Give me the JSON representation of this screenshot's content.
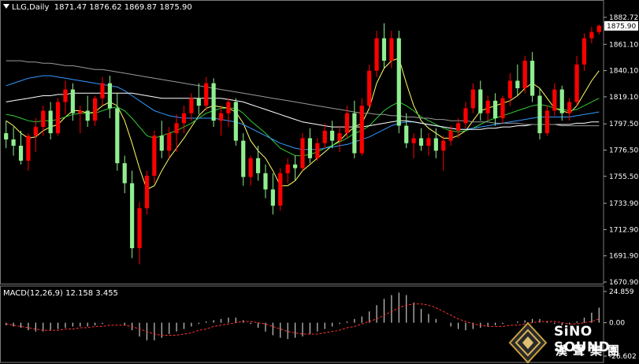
{
  "header": {
    "symbol": "LLG,Daily",
    "ohlc": "1871.47 1876.62 1869.87 1875.90",
    "macd_label": "MACD(12,26,9) 12.158 3.455"
  },
  "brand": {
    "name_en": "SiNO SOUND",
    "name_zh": "漢聲集團"
  },
  "colors": {
    "background": "#000000",
    "bull_candle": "#ff0000",
    "bear_candle": "#90ee90",
    "ma_yellow": "#ffff66",
    "ma_green": "#33cc33",
    "ma_blue": "#3399ff",
    "ma_white": "#ffffff",
    "ma_gray": "#999999",
    "macd_hist": "#c8c8c8",
    "macd_signal": "#ff3333"
  },
  "chart_data": [
    {
      "type": "candlestick",
      "name": "LLG,Daily",
      "ylim": [
        1670.9,
        1882.72
      ],
      "yticks": [
        1882.72,
        1861.1,
        1840.1,
        1819.1,
        1797.5,
        1776.5,
        1755.5,
        1733.9,
        1712.9,
        1691.9,
        1670.9
      ],
      "current_price": 1875.9,
      "current_price_label": "1875.90",
      "ohlc": [
        [
          1790,
          1800,
          1778,
          1785
        ],
        [
          1785,
          1795,
          1772,
          1780
        ],
        [
          1780,
          1792,
          1765,
          1768
        ],
        [
          1768,
          1790,
          1760,
          1788
        ],
        [
          1788,
          1802,
          1775,
          1795
        ],
        [
          1795,
          1812,
          1788,
          1808
        ],
        [
          1808,
          1815,
          1785,
          1790
        ],
        [
          1790,
          1818,
          1788,
          1815
        ],
        [
          1815,
          1832,
          1805,
          1825
        ],
        [
          1825,
          1830,
          1800,
          1806
        ],
        [
          1806,
          1812,
          1790,
          1808
        ],
        [
          1808,
          1820,
          1795,
          1800
        ],
        [
          1800,
          1820,
          1796,
          1818
        ],
        [
          1818,
          1835,
          1812,
          1830
        ],
        [
          1830,
          1836,
          1802,
          1810
        ],
        [
          1810,
          1822,
          1760,
          1766
        ],
        [
          1766,
          1772,
          1742,
          1750
        ],
        [
          1750,
          1760,
          1690,
          1698
        ],
        [
          1698,
          1735,
          1685,
          1730
        ],
        [
          1730,
          1760,
          1725,
          1756
        ],
        [
          1756,
          1792,
          1750,
          1788
        ],
        [
          1788,
          1800,
          1770,
          1776
        ],
        [
          1776,
          1795,
          1770,
          1790
        ],
        [
          1790,
          1805,
          1775,
          1798
        ],
        [
          1798,
          1812,
          1790,
          1806
        ],
        [
          1806,
          1822,
          1800,
          1818
        ],
        [
          1818,
          1830,
          1805,
          1812
        ],
        [
          1812,
          1835,
          1808,
          1830
        ],
        [
          1830,
          1834,
          1795,
          1800
        ],
        [
          1800,
          1812,
          1788,
          1806
        ],
        [
          1806,
          1818,
          1795,
          1815
        ],
        [
          1815,
          1818,
          1780,
          1784
        ],
        [
          1784,
          1790,
          1748,
          1755
        ],
        [
          1755,
          1772,
          1748,
          1770
        ],
        [
          1770,
          1780,
          1752,
          1758
        ],
        [
          1758,
          1765,
          1738,
          1745
        ],
        [
          1745,
          1758,
          1725,
          1732
        ],
        [
          1732,
          1762,
          1728,
          1758
        ],
        [
          1758,
          1770,
          1750,
          1765
        ],
        [
          1765,
          1772,
          1752,
          1762
        ],
        [
          1762,
          1790,
          1760,
          1786
        ],
        [
          1786,
          1794,
          1766,
          1770
        ],
        [
          1770,
          1786,
          1768,
          1782
        ],
        [
          1782,
          1798,
          1778,
          1792
        ],
        [
          1792,
          1800,
          1778,
          1784
        ],
        [
          1784,
          1796,
          1775,
          1790
        ],
        [
          1790,
          1812,
          1786,
          1806
        ],
        [
          1806,
          1816,
          1770,
          1774
        ],
        [
          1774,
          1818,
          1772,
          1812
        ],
        [
          1812,
          1845,
          1810,
          1840
        ],
        [
          1840,
          1872,
          1835,
          1866
        ],
        [
          1866,
          1878,
          1842,
          1848
        ],
        [
          1848,
          1872,
          1842,
          1866
        ],
        [
          1866,
          1872,
          1790,
          1796
        ],
        [
          1796,
          1806,
          1778,
          1782
        ],
        [
          1782,
          1790,
          1770,
          1786
        ],
        [
          1786,
          1794,
          1776,
          1780
        ],
        [
          1780,
          1790,
          1772,
          1786
        ],
        [
          1786,
          1794,
          1770,
          1776
        ],
        [
          1776,
          1788,
          1760,
          1784
        ],
        [
          1784,
          1796,
          1780,
          1792
        ],
        [
          1792,
          1802,
          1786,
          1798
        ],
        [
          1798,
          1815,
          1794,
          1810
        ],
        [
          1810,
          1830,
          1806,
          1825
        ],
        [
          1825,
          1832,
          1800,
          1806
        ],
        [
          1806,
          1820,
          1800,
          1816
        ],
        [
          1816,
          1822,
          1796,
          1802
        ],
        [
          1802,
          1820,
          1798,
          1818
        ],
        [
          1818,
          1838,
          1812,
          1832
        ],
        [
          1832,
          1845,
          1820,
          1826
        ],
        [
          1826,
          1852,
          1822,
          1848
        ],
        [
          1848,
          1855,
          1815,
          1820
        ],
        [
          1820,
          1826,
          1785,
          1790
        ],
        [
          1790,
          1812,
          1788,
          1808
        ],
        [
          1808,
          1830,
          1804,
          1825
        ],
        [
          1825,
          1828,
          1800,
          1806
        ],
        [
          1806,
          1818,
          1800,
          1815
        ],
        [
          1815,
          1852,
          1812,
          1845
        ],
        [
          1845,
          1870,
          1840,
          1866
        ],
        [
          1866,
          1875,
          1862,
          1871
        ],
        [
          1871,
          1877,
          1869,
          1876
        ]
      ],
      "moving_averages": [
        {
          "color": "yellow",
          "values": [
            1800,
            1796,
            1790,
            1786,
            1787,
            1792,
            1795,
            1797,
            1803,
            1808,
            1808,
            1806,
            1807,
            1812,
            1815,
            1812,
            1800,
            1782,
            1762,
            1745,
            1748,
            1760,
            1770,
            1778,
            1786,
            1795,
            1804,
            1810,
            1812,
            1811,
            1810,
            1807,
            1798,
            1784,
            1776,
            1770,
            1760,
            1748,
            1748,
            1752,
            1760,
            1765,
            1770,
            1775,
            1780,
            1784,
            1790,
            1795,
            1798,
            1810,
            1830,
            1842,
            1848,
            1850,
            1830,
            1812,
            1800,
            1794,
            1790,
            1786,
            1786,
            1788,
            1792,
            1800,
            1808,
            1810,
            1812,
            1814,
            1816,
            1820,
            1826,
            1830,
            1826,
            1818,
            1810,
            1808,
            1806,
            1812,
            1822,
            1832,
            1840
          ]
        },
        {
          "color": "green",
          "values": [
            1805,
            1804,
            1802,
            1800,
            1799,
            1800,
            1800,
            1801,
            1803,
            1805,
            1806,
            1806,
            1806,
            1808,
            1810,
            1811,
            1808,
            1802,
            1795,
            1788,
            1786,
            1788,
            1790,
            1792,
            1795,
            1798,
            1802,
            1806,
            1808,
            1810,
            1810,
            1810,
            1806,
            1800,
            1795,
            1790,
            1784,
            1778,
            1775,
            1772,
            1772,
            1773,
            1775,
            1778,
            1780,
            1783,
            1786,
            1790,
            1792,
            1796,
            1802,
            1808,
            1812,
            1815,
            1812,
            1808,
            1803,
            1800,
            1797,
            1794,
            1792,
            1791,
            1792,
            1794,
            1797,
            1800,
            1802,
            1804,
            1806,
            1808,
            1810,
            1812,
            1813,
            1812,
            1810,
            1809,
            1808,
            1809,
            1812,
            1815,
            1818
          ]
        },
        {
          "color": "blue",
          "values": [
            1828,
            1830,
            1832,
            1834,
            1835,
            1836,
            1836,
            1835,
            1834,
            1833,
            1832,
            1831,
            1830,
            1829,
            1828,
            1827,
            1824,
            1820,
            1816,
            1812,
            1808,
            1806,
            1804,
            1803,
            1802,
            1802,
            1802,
            1802,
            1802,
            1801,
            1800,
            1799,
            1797,
            1794,
            1791,
            1788,
            1785,
            1782,
            1780,
            1778,
            1777,
            1777,
            1777,
            1778,
            1779,
            1780,
            1781,
            1783,
            1785,
            1787,
            1790,
            1793,
            1796,
            1798,
            1799,
            1799,
            1798,
            1797,
            1796,
            1795,
            1794,
            1793,
            1793,
            1794,
            1795,
            1796,
            1797,
            1798,
            1799,
            1800,
            1801,
            1802,
            1803,
            1803,
            1803,
            1803,
            1803,
            1804,
            1805,
            1806,
            1807
          ]
        },
        {
          "color": "white",
          "values": [
            1815,
            1816,
            1817,
            1818,
            1819,
            1820,
            1820,
            1821,
            1821,
            1822,
            1822,
            1822,
            1822,
            1822,
            1822,
            1822,
            1822,
            1822,
            1821,
            1820,
            1819,
            1818,
            1818,
            1818,
            1818,
            1818,
            1818,
            1818,
            1818,
            1818,
            1817,
            1816,
            1815,
            1813,
            1811,
            1809,
            1807,
            1805,
            1803,
            1801,
            1799,
            1798,
            1797,
            1796,
            1795,
            1795,
            1795,
            1795,
            1795,
            1796,
            1797,
            1798,
            1799,
            1800,
            1800,
            1799,
            1798,
            1797,
            1796,
            1795,
            1794,
            1793,
            1793,
            1793,
            1793,
            1794,
            1794,
            1795,
            1795,
            1796,
            1796,
            1797,
            1797,
            1797,
            1797,
            1797,
            1797,
            1798,
            1798,
            1799,
            1799
          ]
        },
        {
          "color": "gray",
          "values": [
            1848,
            1848,
            1848,
            1847,
            1847,
            1846,
            1846,
            1845,
            1844,
            1844,
            1843,
            1842,
            1841,
            1841,
            1840,
            1839,
            1838,
            1837,
            1836,
            1835,
            1834,
            1833,
            1832,
            1831,
            1830,
            1829,
            1828,
            1827,
            1826,
            1825,
            1824,
            1823,
            1822,
            1821,
            1820,
            1819,
            1818,
            1817,
            1816,
            1815,
            1814,
            1813,
            1812,
            1811,
            1810,
            1809,
            1808,
            1807,
            1806,
            1806,
            1805,
            1805,
            1804,
            1804,
            1803,
            1803,
            1802,
            1802,
            1801,
            1801,
            1800,
            1800,
            1800,
            1799,
            1799,
            1799,
            1798,
            1798,
            1798,
            1798,
            1797,
            1797,
            1797,
            1797,
            1797,
            1796,
            1796,
            1796,
            1796,
            1796,
            1796
          ]
        }
      ]
    },
    {
      "type": "bar",
      "name": "MACD(12,26,9)",
      "macd_value": 12.158,
      "signal_value": 3.455,
      "ylim": [
        -26.602,
        24.859
      ],
      "yticks": [
        24.859,
        0.0,
        -26.602
      ],
      "histogram": [
        -2,
        -3,
        -4,
        -6,
        -7,
        -7,
        -6,
        -5,
        -4,
        -3,
        -3,
        -3,
        -2,
        -1,
        0,
        0,
        -2,
        -6,
        -11,
        -14,
        -14,
        -12,
        -9,
        -7,
        -5,
        -3,
        -1,
        1,
        2,
        3,
        4,
        4,
        2,
        -1,
        -4,
        -7,
        -10,
        -12,
        -13,
        -12,
        -11,
        -9,
        -7,
        -5,
        -3,
        -1,
        1,
        3,
        5,
        9,
        14,
        19,
        22,
        24,
        22,
        16,
        11,
        7,
        3,
        0,
        -3,
        -5,
        -6,
        -5,
        -4,
        -3,
        -2,
        -1,
        0,
        1,
        2,
        3,
        3,
        1,
        -1,
        -2,
        -1,
        1,
        4,
        8,
        12
      ],
      "signal": [
        -1,
        -2,
        -3,
        -4,
        -5,
        -6,
        -6,
        -6,
        -5,
        -5,
        -4,
        -4,
        -3,
        -3,
        -2,
        -2,
        -2,
        -3,
        -5,
        -7,
        -9,
        -10,
        -10,
        -10,
        -9,
        -8,
        -6,
        -5,
        -3,
        -2,
        -1,
        0,
        1,
        1,
        0,
        -1,
        -3,
        -5,
        -7,
        -8,
        -9,
        -9,
        -9,
        -8,
        -7,
        -6,
        -4,
        -3,
        -1,
        1,
        3,
        6,
        9,
        12,
        14,
        15,
        15,
        14,
        12,
        9,
        6,
        3,
        1,
        -1,
        -2,
        -3,
        -3,
        -3,
        -2,
        -2,
        -1,
        0,
        1,
        1,
        1,
        0,
        -1,
        -1,
        0,
        1,
        3
      ]
    }
  ]
}
